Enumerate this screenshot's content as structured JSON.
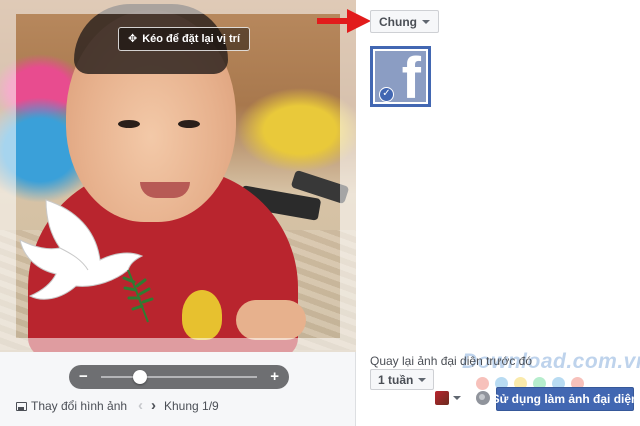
{
  "editor": {
    "drag_hint": "Kéo để đặt lại vị trí",
    "move_icon": "✥",
    "zoom_level": 0.25,
    "zoom_minus": "−",
    "zoom_plus": "+",
    "change_image_label": "Thay đổi hình ảnh",
    "frame_counter": "Khung 1/9",
    "prev_icon": "‹",
    "next_icon": "›"
  },
  "frames_panel": {
    "category_label": "Chung",
    "selected_thumb_glyph": "f",
    "check_glyph": "✓",
    "revert_label": "Quay lại ảnh đại diện trước đó",
    "duration_value": "1 tuần",
    "use_button_label": "Sử dụng làm ảnh đại diện"
  },
  "watermark": {
    "text": "Download.com.vn",
    "dot_colors": [
      "#e74c3c",
      "#3498db",
      "#f1c40f",
      "#2ecc71",
      "#3498db",
      "#e74c3c"
    ]
  },
  "colors": {
    "accent": "#4267b2",
    "arrow": "#e21b1b"
  }
}
